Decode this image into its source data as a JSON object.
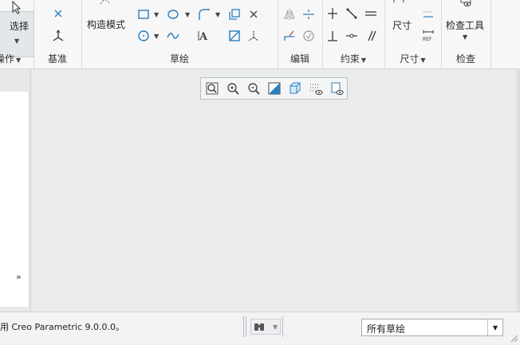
{
  "ribbon": {
    "operations": {
      "select_label": "选择",
      "group_label": "操作"
    },
    "datum": {
      "group_label": "基准"
    },
    "sketch": {
      "construction_mode_label": "构造模式",
      "group_label": "草绘"
    },
    "edit": {
      "group_label": "编辑"
    },
    "constraints": {
      "group_label": "约束"
    },
    "dimension": {
      "dimension_label": "尺寸",
      "group_label": "尺寸"
    },
    "inspect": {
      "inspect_tool_label": "检查工具",
      "group_label": "检查"
    }
  },
  "status_bar": {
    "message": "用 Creo Parametric 9.0.0.0。",
    "filter_value": "所有草绘"
  },
  "colors": {
    "accent": "#2a7fbf",
    "ribbon_bg": "#f7f7f7",
    "canvas_bg": "#e9ebed"
  }
}
